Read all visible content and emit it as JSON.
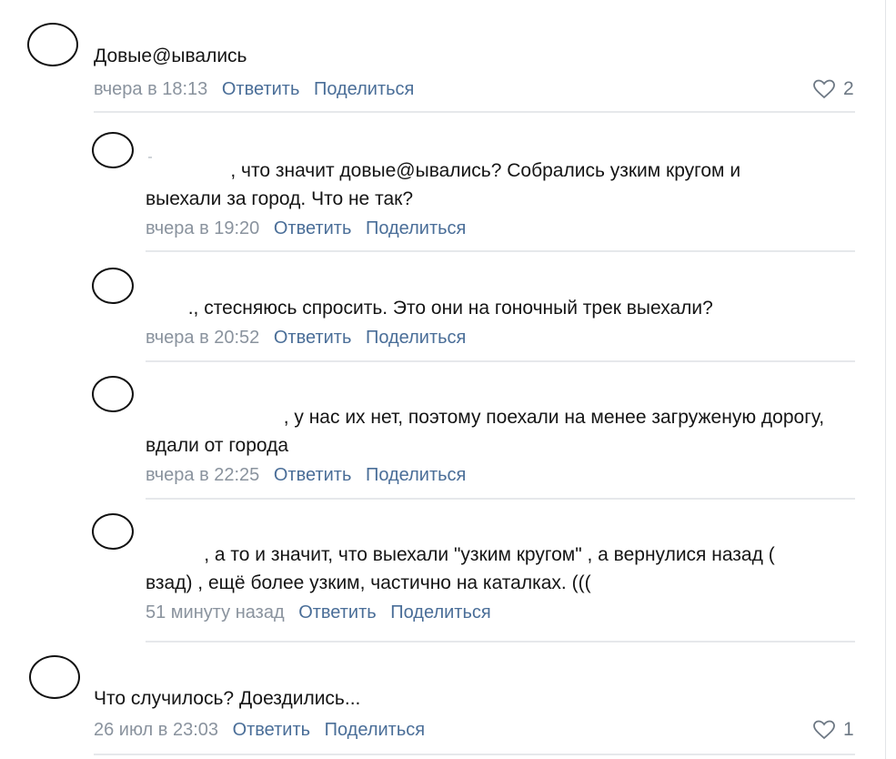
{
  "comments": [
    {
      "text": "Довые@ывались",
      "time": "вчера в 18:13",
      "reply_label": "Ответить",
      "share_label": "Поделиться",
      "likes": "2"
    },
    {
      "text": "                , что значит довые@ывались? Собрались узким кругом и\nвыехали за город. Что не так?",
      "time": "вчера в 19:20",
      "reply_label": "Ответить",
      "share_label": "Поделиться"
    },
    {
      "text": "        ., стесняюсь спросить. Это они на гоночный трек выехали?",
      "time": "вчера в 20:52",
      "reply_label": "Ответить",
      "share_label": "Поделиться"
    },
    {
      "text": "                          , у нас их нет, поэтому поехали на менее загруженую дорогу,\nвдали от города",
      "time": "вчера в 22:25",
      "reply_label": "Ответить",
      "share_label": "Поделиться"
    },
    {
      "text": "           , а то и значит, что выехали \"узким кругом\" , а вернулися назад (\nвзад) , ещё более узким, частично на каталках. (((",
      "time": "51 минуту назад",
      "reply_label": "Ответить",
      "share_label": "Поделиться"
    },
    {
      "text": "Что случилось? Доездились...",
      "time": "26 июл в 23:03",
      "reply_label": "Ответить",
      "share_label": "Поделиться",
      "likes": "1"
    }
  ],
  "colors": {
    "link": "#4a6e98",
    "meta": "#8a939e",
    "text": "#151515",
    "separator": "#e6e8eb"
  },
  "icons": {
    "avatar": "avatar-placeholder",
    "like": "heart-outline-icon"
  }
}
